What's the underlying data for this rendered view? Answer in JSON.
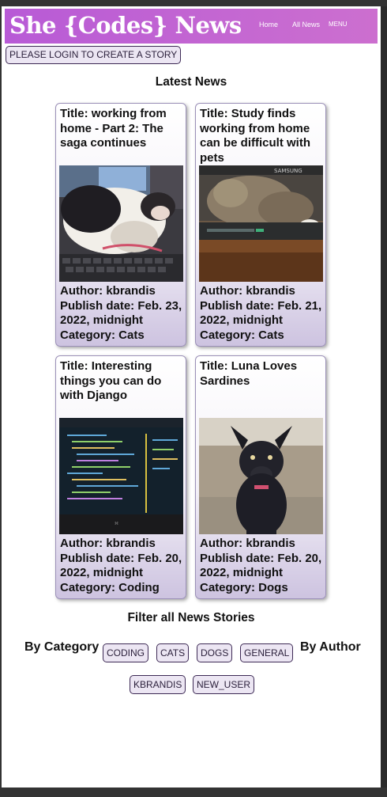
{
  "header": {
    "brand": "She {Codes} News",
    "nav": {
      "home": "Home",
      "all_news": "All News",
      "menu": "MENU"
    }
  },
  "login_button": "PLEASE LOGIN TO CREATE A STORY",
  "latest_title": "Latest News",
  "cards": [
    {
      "title": "Title: working from home - Part 2: The saga continues",
      "author": "Author: kbrandis",
      "date": "Publish date: Feb. 23, 2022, midnight",
      "category": "Category: Cats",
      "image": "cat-sleeping-on-keyboard"
    },
    {
      "title": "Title: Study finds working from home can be difficult with pets",
      "author": "Author: kbrandis",
      "date": "Publish date: Feb. 21, 2022, midnight",
      "category": "Category: Cats",
      "image": "cat-on-laptop"
    },
    {
      "title": "Title: Interesting things you can do with Django",
      "author": "Author: kbrandis",
      "date": "Publish date: Feb. 20, 2022, midnight",
      "category": "Category: Coding",
      "image": "code-on-laptop-screen"
    },
    {
      "title": "Title: Luna Loves Sardines",
      "author": "Author: kbrandis",
      "date": "Publish date: Feb. 20, 2022, midnight",
      "category": "Category: Dogs",
      "image": "black-dog"
    }
  ],
  "filter": {
    "title": "Filter all News Stories",
    "by_category": "By Category",
    "by_author": "By Author",
    "categories": [
      "CODING",
      "CATS",
      "DOGS",
      "GENERAL"
    ],
    "authors": [
      "KBRANDIS",
      "NEW_USER"
    ]
  },
  "colors": {
    "header_accent": "#c366d2",
    "button_border": "#3d2a55",
    "card_border": "#9b90b8"
  }
}
